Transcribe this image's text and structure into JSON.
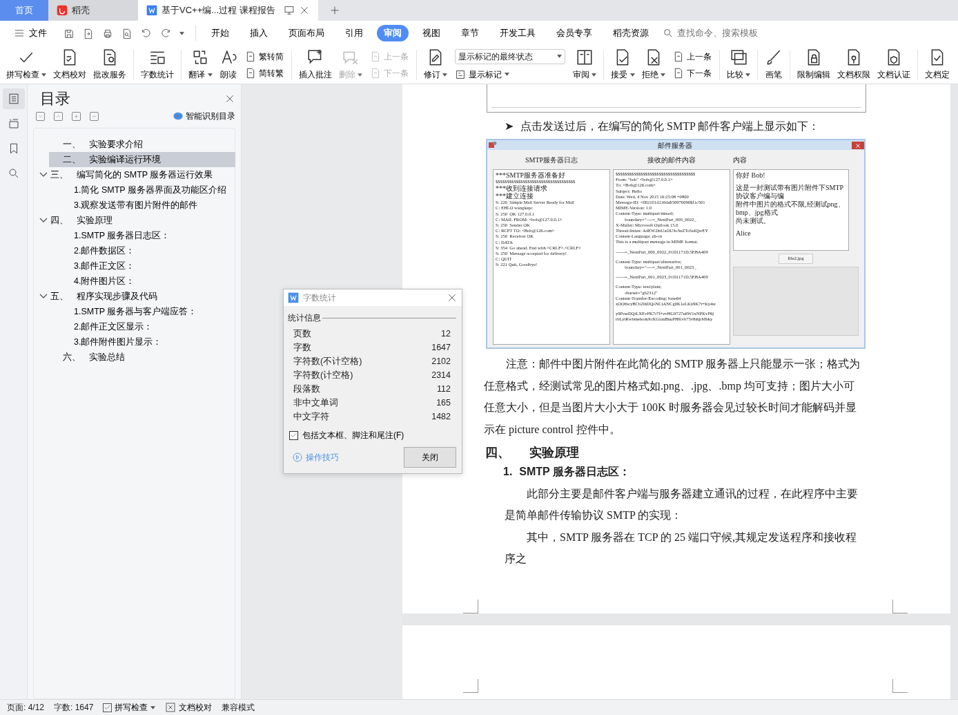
{
  "app_tabs": [
    {
      "kind": "home",
      "label": "首页",
      "selected": false
    },
    {
      "kind": "brand",
      "label": "稻壳",
      "selected": false
    },
    {
      "kind": "doc",
      "label": "基于VC++编...过程 课程报告",
      "selected": true
    }
  ],
  "menu": {
    "file": "文件",
    "tabs": [
      {
        "label": "开始",
        "selected": false
      },
      {
        "label": "插入",
        "selected": false
      },
      {
        "label": "页面布局",
        "selected": false
      },
      {
        "label": "引用",
        "selected": false
      },
      {
        "label": "审阅",
        "selected": true
      },
      {
        "label": "视图",
        "selected": false
      },
      {
        "label": "章节",
        "selected": false
      },
      {
        "label": "开发工具",
        "selected": false
      },
      {
        "label": "会员专享",
        "selected": false
      },
      {
        "label": "稻壳资源",
        "selected": false
      }
    ],
    "search": {
      "placeholder": "查找命令、搜索模板"
    }
  },
  "ribbon": [
    {
      "kind": "large",
      "label": "拼写检查",
      "caret": true,
      "disabled": false
    },
    {
      "kind": "large",
      "label": "文档校对",
      "caret": false,
      "disabled": false
    },
    {
      "kind": "large",
      "label": "批改服务",
      "caret": false,
      "disabled": false
    },
    {
      "kind": "sep"
    },
    {
      "kind": "large",
      "label": "字数统计",
      "caret": false,
      "disabled": false
    },
    {
      "kind": "sep"
    },
    {
      "kind": "large",
      "label": "翻译",
      "caret": true,
      "disabled": false
    },
    {
      "kind": "large",
      "label": "朗读",
      "caret": false,
      "disabled": false
    },
    {
      "kind": "stack",
      "items": [
        {
          "label": "繁转简",
          "disabled": false
        },
        {
          "label": "简转繁",
          "disabled": false
        }
      ]
    },
    {
      "kind": "sep"
    },
    {
      "kind": "large",
      "label": "插入批注",
      "caret": false,
      "disabled": false
    },
    {
      "kind": "large",
      "label": "删除",
      "caret": true,
      "disabled": true
    },
    {
      "kind": "stack",
      "items": [
        {
          "label": "上一条",
          "disabled": true
        },
        {
          "label": "下一条",
          "disabled": true
        }
      ]
    },
    {
      "kind": "sep"
    },
    {
      "kind": "large",
      "label": "修订",
      "caret": true,
      "disabled": false
    },
    {
      "kind": "select",
      "value": "显示标记的最终状态",
      "label": "显示标记"
    },
    {
      "kind": "large",
      "label": "审阅",
      "caret": true,
      "disabled": false
    },
    {
      "kind": "sep"
    },
    {
      "kind": "large",
      "label": "接受",
      "caret": true,
      "disabled": false
    },
    {
      "kind": "large",
      "label": "拒绝",
      "caret": true,
      "disabled": false
    },
    {
      "kind": "stack",
      "items": [
        {
          "label": "上一条",
          "disabled": false
        },
        {
          "label": "下一条",
          "disabled": false
        }
      ]
    },
    {
      "kind": "sep"
    },
    {
      "kind": "large",
      "label": "比较",
      "caret": true,
      "disabled": false
    },
    {
      "kind": "sep"
    },
    {
      "kind": "large",
      "label": "画笔",
      "caret": false,
      "disabled": false
    },
    {
      "kind": "sep"
    },
    {
      "kind": "large",
      "label": "限制编辑",
      "caret": false,
      "disabled": false
    },
    {
      "kind": "large",
      "label": "文档权限",
      "caret": false,
      "disabled": false
    },
    {
      "kind": "large",
      "label": "文档认证",
      "caret": false,
      "disabled": false
    },
    {
      "kind": "sep"
    },
    {
      "kind": "large",
      "label": "文档定",
      "caret": false,
      "disabled": false
    }
  ],
  "sidebar": {
    "rail": [
      {
        "selected": true
      },
      {
        "selected": false
      },
      {
        "selected": false
      },
      {
        "selected": false
      }
    ]
  },
  "toc": {
    "title": "目录",
    "smart": "智能识别目录",
    "items": [
      {
        "num": "一、",
        "text": "实验要求介绍",
        "selected": false
      },
      {
        "num": "二、",
        "text": "实验编译运行环境",
        "selected": true
      },
      {
        "num": "三、",
        "text": "编写简化的 SMTP 服务器运行效果",
        "selected": false,
        "expanded": true,
        "children": [
          {
            "text": "1.简化 SMTP 服务器界面及功能区介绍",
            "selected": false
          },
          {
            "text": "3.观察发送带有图片附件的邮件",
            "selected": false
          }
        ]
      },
      {
        "num": "四、",
        "text": "实验原理",
        "selected": false,
        "expanded": true,
        "children": [
          {
            "text": "1.SMTP 服务器日志区：",
            "selected": false
          },
          {
            "text": "2.邮件数据区：",
            "selected": false
          },
          {
            "text": "3.邮件正文区：",
            "selected": false
          },
          {
            "text": "4.附件图片区：",
            "selected": false
          }
        ]
      },
      {
        "num": "五、",
        "text": "程序实现步骤及代码",
        "selected": false,
        "expanded": true,
        "children": [
          {
            "text": "1.SMTP 服务器与客户端应答：",
            "selected": false
          },
          {
            "text": "2.邮件正文区显示：",
            "selected": false
          },
          {
            "text": "3.邮件附件图片显示：",
            "selected": false
          }
        ]
      },
      {
        "num": "六、",
        "text": "实验总结",
        "selected": false
      }
    ]
  },
  "document": {
    "bullet": "➤",
    "bullet_text": "点击发送过后，在编写的简化 SMTP 邮件客户端上显示如下：",
    "figure": {
      "title": "邮件服务器",
      "headers": [
        "SMTP服务器日志",
        "接收的邮件内容",
        "内容"
      ],
      "log": [
        "***SMTP服务器准备好",
        "$$$$$$$$$$$$$$$$$$$$$$$$$$$$$$$$$$$",
        "***收到连接请求",
        "***建立连接",
        "S: 220  Simple Mail Server Ready for Mail",
        "C: EHLO wangkepc",
        "S: 250  OK 127.0.0.1",
        "C: MAIL FROM: <bob@127.0.0.1>",
        "S: 250  Sender OK",
        "C: RCPT TO: <Bob@126.com>",
        "S: 250  Receiver OK",
        "C: DATA",
        "S: 354  Go ahead. End with <CRLF>.<CRLF>",
        "S: 250  Message accepted for delivery!",
        "C: QUIT",
        "S: 221 Quit, Goodbye!"
      ],
      "mail": [
        "$$$$$$$$$$$$$$$$$$$$$$$$$$$$$$$$$$$",
        "From: \"bob\" <bob@127.0.0.1>",
        "To: <Bob@126.com>",
        "Subject: Hello",
        "Date: Wed, 4 Nov 2015 16:25:08 +0800",
        "Message-ID: <002101d116da$50970090$f1c501",
        "MIME-Version: 1.0",
        "Content-Type: multipart/mixed;",
        "        boundary=\"----=_NextPart_000_0022_",
        "X-Mailer: Microsoft Outlook 15.0",
        "Thread-Index: AdEW2htUaOU3o3nZToSulQwEY",
        "Content-Language: zh-cn",
        "This is a multipart message in MIME format.",
        "------=_NextPart_000_0022_01D1171D.5EBA409",
        "Content-Type: multipart/alternative;",
        "        boundary=\"----=_NextPart_001_0023_",
        "------=_NextPart_001_0023_01D1171D.5EBA409",
        "Content-Type: text/plain;",
        "        charset=\"gb2312\"",
        "Content-Transfer-Encoding: base64",
        "xOO6wyBCb2lhDQoNCiANCg0K1eLKx9K7t+Ky4sr",
        "y9PrseDQtLXEvPK7r7f+zvHG9727u6W1xNPKvP6j",
        "rbLytRwbmehomJtcKGianBnuPHKvb75v8mjrMbky"
      ],
      "content": [
        "你好 Bob!",
        "这是一封测试带有图片附件下SMTP协议客户编与编",
        "附件中图片的格式不限,经测试png、bmp、jpg格式",
        "尚未测试。",
        "Alice"
      ],
      "file": "file2.jpg"
    },
    "paragraphs": [
      {
        "kind": "body",
        "text": "注意：邮件中图片附件在此简化的 SMTP 服务器上只能显示一张；格式为任意格式，经测试常见的图片格式如.png、.jpg、.bmp 均可支持；图片大小可任意大小，但是当图片大小大于 100K 时服务器会见过较长时间才能解码并显示在 picture control 控件中。"
      },
      {
        "kind": "h1",
        "num": "四、",
        "text": "实验原理"
      },
      {
        "kind": "h2",
        "num": "1.",
        "text": "SMTP 服务器日志区："
      },
      {
        "kind": "body2",
        "text": "此部分主要是邮件客户端与服务器建立通讯的过程，在此程序中主要是简单邮件传输协议 SMTP 的实现："
      },
      {
        "kind": "body2",
        "text": "其中，SMTP 服务器在 TCP 的 25 端口守候,其规定发送程序和接收程序之"
      }
    ]
  },
  "dialog": {
    "title": "字数统计",
    "group": "统计信息",
    "rows": [
      {
        "label": "页数",
        "value": "12"
      },
      {
        "label": "字数",
        "value": "1647"
      },
      {
        "label": "字符数(不计空格)",
        "value": "2102"
      },
      {
        "label": "字符数(计空格)",
        "value": "2314"
      },
      {
        "label": "段落数",
        "value": "112"
      },
      {
        "label": "非中文单词",
        "value": "165"
      },
      {
        "label": "中文字符",
        "value": "1482"
      }
    ],
    "checkbox": {
      "label": "包括文本框、脚注和尾注(F)",
      "checked": true
    },
    "tips": "操作技巧",
    "close": "关闭"
  },
  "status_bar": {
    "page": "页面: 4/12",
    "words": "字数: 1647",
    "spell": {
      "label": "拼写检查",
      "checked": true
    },
    "proof": "文档校对",
    "mode": "兼容模式"
  }
}
